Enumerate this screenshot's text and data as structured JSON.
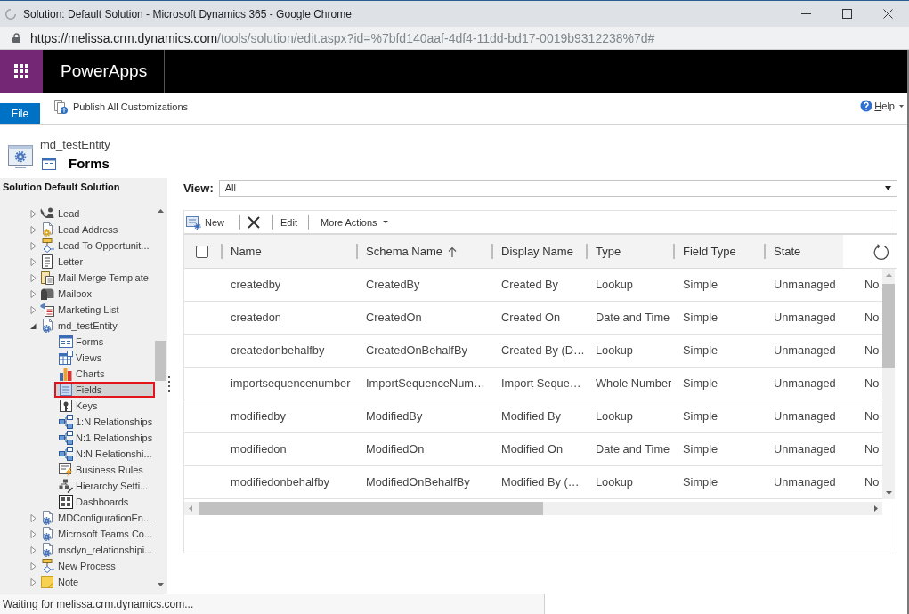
{
  "browser": {
    "title": "Solution: Default Solution - Microsoft Dynamics 365 - Google Chrome",
    "loading": true,
    "address": {
      "host": "https://melissa.crm.dynamics.com",
      "path": "/tools/solution/edit.aspx?id=%7bfd140aaf-4df4-11dd-bd17-0019b9312238%7d#"
    }
  },
  "app_bar": {
    "title": "PowerApps"
  },
  "ribbon": {
    "file_tab": "File",
    "publish_button": "Publish All Customizations",
    "help_button": "Help"
  },
  "entity_header": {
    "entity": "md_testEntity",
    "component": "Forms"
  },
  "sidebar": {
    "title": "Solution Default Solution",
    "items": [
      {
        "label": "Lead",
        "expanded": false,
        "selected": false
      },
      {
        "label": "Lead Address",
        "expanded": false,
        "selected": false
      },
      {
        "label": "Lead To Opportunit...",
        "expanded": false,
        "selected": false
      },
      {
        "label": "Letter",
        "expanded": false,
        "selected": false
      },
      {
        "label": "Mail Merge Template",
        "expanded": false,
        "selected": false
      },
      {
        "label": "Mailbox",
        "expanded": false,
        "selected": false
      },
      {
        "label": "Marketing List",
        "expanded": false,
        "selected": false
      },
      {
        "label": "md_testEntity",
        "expanded": true,
        "selected": false,
        "children": [
          {
            "label": "Forms",
            "selected": false
          },
          {
            "label": "Views",
            "selected": false
          },
          {
            "label": "Charts",
            "selected": false
          },
          {
            "label": "Fields",
            "selected": true
          },
          {
            "label": "Keys",
            "selected": false
          },
          {
            "label": "1:N Relationships",
            "selected": false
          },
          {
            "label": "N:1 Relationships",
            "selected": false
          },
          {
            "label": "N:N Relationshi...",
            "selected": false
          },
          {
            "label": "Business Rules",
            "selected": false
          },
          {
            "label": "Hierarchy Setti...",
            "selected": false
          },
          {
            "label": "Dashboards",
            "selected": false
          }
        ]
      },
      {
        "label": "MDConfigurationEn...",
        "expanded": false,
        "selected": false
      },
      {
        "label": "Microsoft Teams Co...",
        "expanded": false,
        "selected": false
      },
      {
        "label": "msdyn_relationshipi...",
        "expanded": false,
        "selected": false
      },
      {
        "label": "New Process",
        "expanded": false,
        "selected": false
      },
      {
        "label": "Note",
        "expanded": false,
        "selected": false
      }
    ]
  },
  "view": {
    "label": "View:",
    "value": "All"
  },
  "grid": {
    "toolbar": {
      "new_button": "New",
      "edit_button": "Edit",
      "more_actions_button": "More Actions"
    },
    "select_all": {
      "checked": false
    },
    "columns": [
      {
        "label": "Name",
        "sorted_ascending": false
      },
      {
        "label": "Schema Name",
        "sorted_ascending": true
      },
      {
        "label": "Display Name",
        "sorted_ascending": false
      },
      {
        "label": "Type",
        "sorted_ascending": false
      },
      {
        "label": "Field Type",
        "sorted_ascending": false
      },
      {
        "label": "State",
        "sorted_ascending": false
      }
    ],
    "rows": [
      {
        "selected": false,
        "cells": [
          "createdby",
          "CreatedBy",
          "Created By",
          "Lookup",
          "Simple",
          "Unmanaged",
          "No"
        ]
      },
      {
        "selected": false,
        "cells": [
          "createdon",
          "CreatedOn",
          "Created On",
          "Date and Time",
          "Simple",
          "Unmanaged",
          "No"
        ]
      },
      {
        "selected": false,
        "cells": [
          "createdonbehalfby",
          "CreatedOnBehalfBy",
          "Created By (D…",
          "Lookup",
          "Simple",
          "Unmanaged",
          "No"
        ]
      },
      {
        "selected": false,
        "cells": [
          "importsequencenumber",
          "ImportSequenceNum…",
          "Import Seque…",
          "Whole Number",
          "Simple",
          "Unmanaged",
          "No"
        ]
      },
      {
        "selected": false,
        "cells": [
          "modifiedby",
          "ModifiedBy",
          "Modified By",
          "Lookup",
          "Simple",
          "Unmanaged",
          "No"
        ]
      },
      {
        "selected": false,
        "cells": [
          "modifiedon",
          "ModifiedOn",
          "Modified On",
          "Date and Time",
          "Simple",
          "Unmanaged",
          "No"
        ]
      },
      {
        "selected": false,
        "cells": [
          "modifiedonbehalfby",
          "ModifiedOnBehalfBy",
          "Modified By (…",
          "Lookup",
          "Simple",
          "Unmanaged",
          "No"
        ]
      }
    ]
  },
  "status_bar": {
    "text": "Waiting for melissa.crm.dynamics.com..."
  }
}
